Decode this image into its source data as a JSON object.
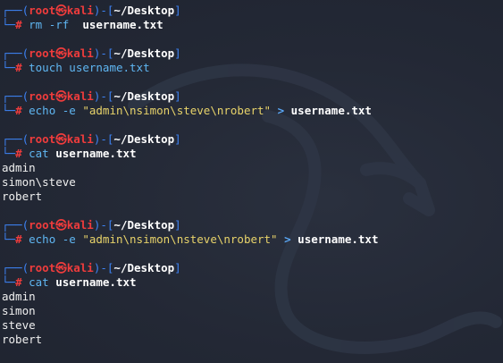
{
  "prompt": {
    "frame_open": "┌──(",
    "user": "root",
    "at_glyph": "㉿",
    "host": "kali",
    "frame_mid": ")-[",
    "path": "~/Desktop",
    "frame_close": "]",
    "second_line": "└─",
    "hash": "#"
  },
  "commands": [
    {
      "cmd": "rm",
      "args": " -rf  ",
      "file": "username.txt"
    },
    {
      "cmd": "touch",
      "args": " username.txt"
    },
    {
      "cmd": "echo",
      "args": " -e ",
      "str": "\"admin\\nsimon\\steve\\nrobert\"",
      "op": " > ",
      "file": "username.txt"
    },
    {
      "cmd": "cat",
      "file": " username.txt",
      "output": [
        "admin",
        "simon\\steve",
        "robert"
      ]
    },
    {
      "cmd": "echo",
      "args": " -e ",
      "str": "\"admin\\nsimon\\nsteve\\nrobert\"",
      "op": " > ",
      "file": "username.txt"
    },
    {
      "cmd": "cat",
      "file": " username.txt",
      "output": [
        "admin",
        "simon",
        "steve",
        "robert"
      ]
    }
  ],
  "colors": {
    "background": "#222733",
    "prompt_frame": "#3d83f5",
    "prompt_user": "#ef3c3c",
    "command": "#5fb6f2",
    "string": "#e8d36a",
    "text": "#ffffff"
  },
  "background_art": "kali-dragon-logo"
}
